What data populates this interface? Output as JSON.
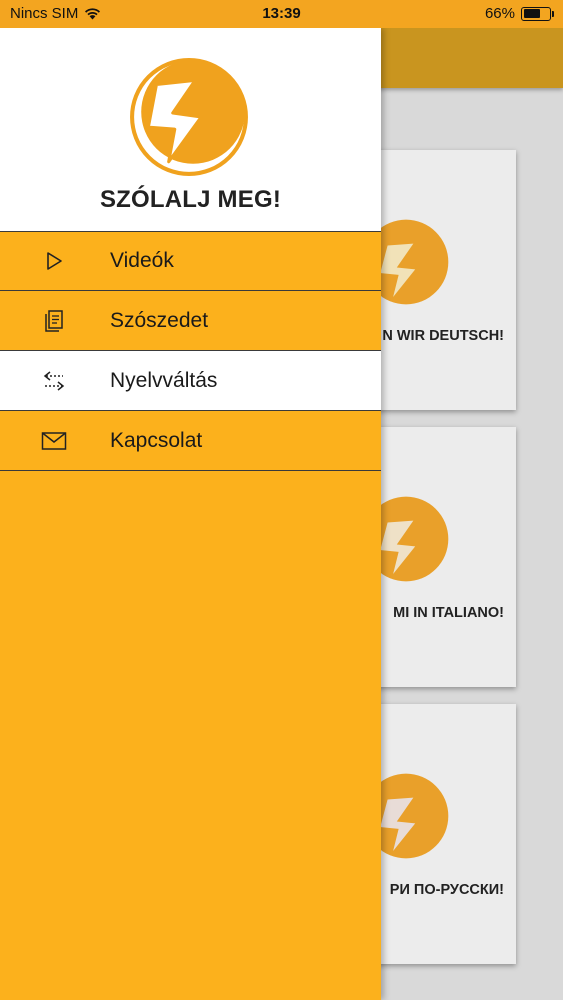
{
  "status_bar": {
    "carrier": "Nincs SIM",
    "time": "13:39",
    "battery_percent": "66%",
    "battery_level": 0.66
  },
  "drawer": {
    "app_title": "SZÓLALJ MEG!",
    "logo_icon": "speech-bubble-lightning-logo",
    "menu": [
      {
        "label": "Videók",
        "icon": "play-icon",
        "selected": false
      },
      {
        "label": "Szószedet",
        "icon": "document-icon",
        "selected": false
      },
      {
        "label": "Nyelvváltás",
        "icon": "swap-arrows-icon",
        "selected": true
      },
      {
        "label": "Kapcsolat",
        "icon": "mail-icon",
        "selected": false
      }
    ]
  },
  "background_cards": [
    {
      "title": "N WIR DEUTSCH!"
    },
    {
      "title": "MI IN ITALIANO!"
    },
    {
      "title": "РИ ПО-РУССКИ!"
    }
  ],
  "colors": {
    "accent": "#fcb11c",
    "status_bar": "#f3a520",
    "logo_orange": "#f0a21e"
  }
}
